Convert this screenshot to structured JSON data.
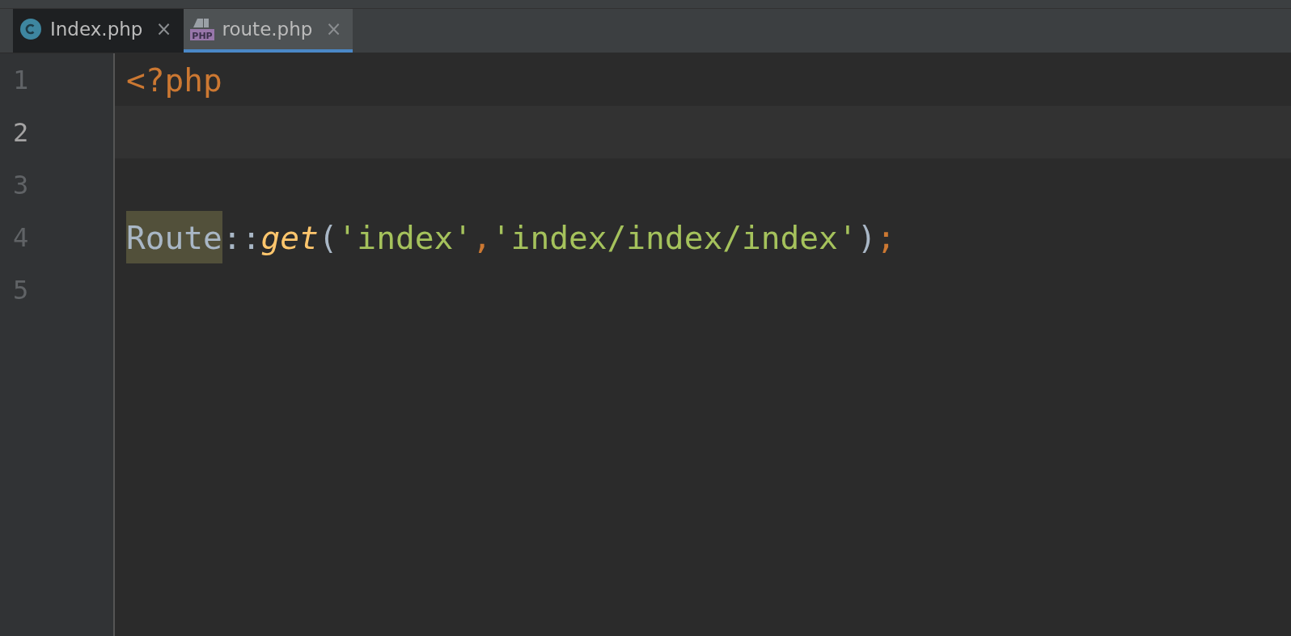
{
  "tabs": [
    {
      "label": "Index.php",
      "selected": false,
      "close": "×"
    },
    {
      "label": "route.php",
      "icon_text": "PHP",
      "selected": true,
      "close": "×"
    }
  ],
  "editor": {
    "lines": [
      {
        "number": "1",
        "current": false,
        "tokens": [
          {
            "kind": "keyword",
            "text": "<?php",
            "highlighted": false
          }
        ]
      },
      {
        "number": "2",
        "current": true
      },
      {
        "number": "3",
        "current": false
      },
      {
        "number": "4",
        "current": false,
        "tokens": [
          {
            "kind": "class",
            "text": "Route",
            "highlighted": true
          },
          {
            "kind": "operator",
            "text": "::",
            "highlighted": false
          },
          {
            "kind": "method",
            "text": "get",
            "highlighted": false
          },
          {
            "kind": "paren",
            "text": "(",
            "highlighted": false
          },
          {
            "kind": "string",
            "text": "'index'",
            "highlighted": false
          },
          {
            "kind": "keyword",
            "text": ",",
            "highlighted": false
          },
          {
            "kind": "string",
            "text": "'index/index/index'",
            "highlighted": false
          },
          {
            "kind": "paren",
            "text": ")",
            "highlighted": false
          },
          {
            "kind": "keyword",
            "text": ";",
            "highlighted": false
          }
        ]
      },
      {
        "number": "5",
        "current": false
      }
    ]
  }
}
